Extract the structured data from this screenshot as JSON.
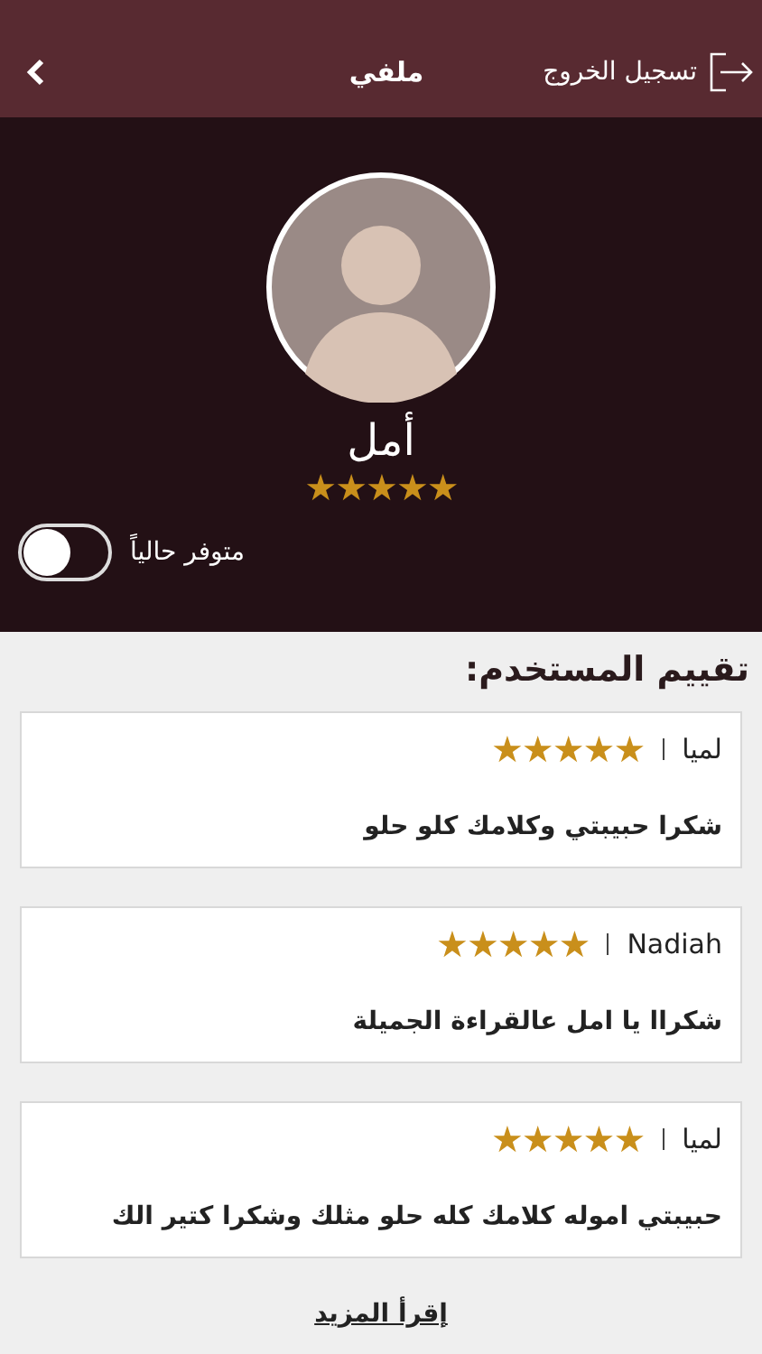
{
  "header": {
    "logout_label": "تسجيل الخروج",
    "title": "ملفي"
  },
  "profile": {
    "name": "أمل",
    "stars": 5,
    "availability": {
      "label": "متوفر حالياً",
      "on": false
    }
  },
  "reviews_title": "تقييم المستخدم:",
  "reviews": [
    {
      "author": "لميا",
      "stars": 5,
      "text": "شكرا حبيبتي وكلامك كلو حلو"
    },
    {
      "author": "Nadiah",
      "stars": 5,
      "text": "شكراا يا امل عالقراءة الجميلة"
    },
    {
      "author": "لميا",
      "stars": 5,
      "text": "حبيبتي اموله كلامك كله حلو مثلك وشكرا كتير الك"
    }
  ],
  "read_more": "إقرأ المزيد"
}
